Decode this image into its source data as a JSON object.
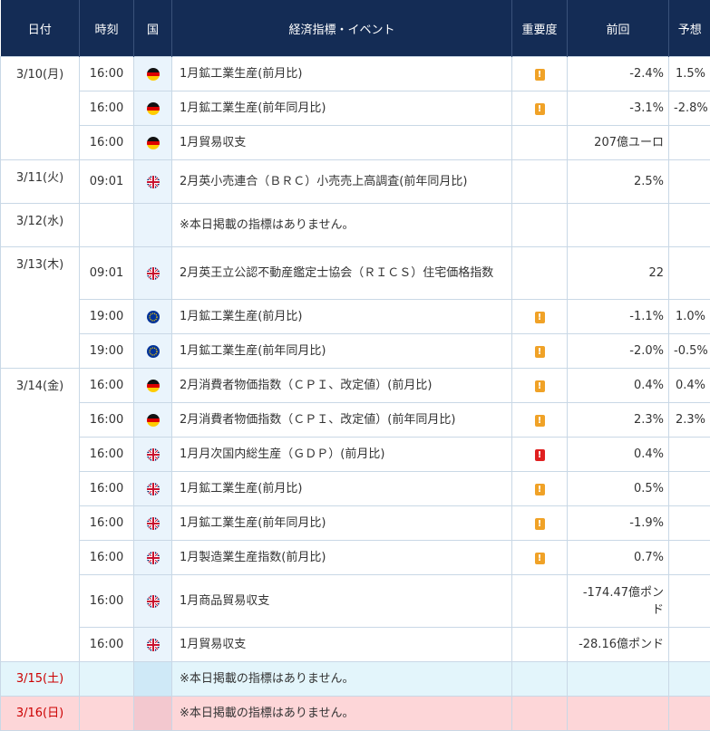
{
  "header": {
    "date": "日付",
    "time": "時刻",
    "country": "国",
    "event": "経済指標・イベント",
    "importance": "重要度",
    "previous": "前回",
    "forecast": "予想"
  },
  "rows": [
    {
      "date": "3/10(月)",
      "time": "16:00",
      "country_icon": "germany-flag-icon",
      "event": "1月鉱工業生産(前月比)",
      "importance": "medium",
      "previous": "-2.4%",
      "forecast": "1.5%"
    },
    {
      "date": "",
      "time": "16:00",
      "country_icon": "germany-flag-icon",
      "event": "1月鉱工業生産(前年同月比)",
      "importance": "medium",
      "previous": "-3.1%",
      "forecast": "-2.8%"
    },
    {
      "date": "",
      "time": "16:00",
      "country_icon": "germany-flag-icon",
      "event": "1月貿易収支",
      "importance": "",
      "previous": "207億ユーロ",
      "forecast": ""
    },
    {
      "date": "3/11(火)",
      "time": "09:01",
      "country_icon": "uk-flag-icon",
      "event": "2月英小売連合（ＢＲＣ）小売売上高調査(前年同月比)",
      "importance": "",
      "previous": "2.5%",
      "forecast": ""
    },
    {
      "date": "3/12(水)",
      "time": "",
      "country_icon": "",
      "event": "※本日掲載の指標はありません。",
      "importance": "",
      "previous": "",
      "forecast": ""
    },
    {
      "date": "3/13(木)",
      "time": "09:01",
      "country_icon": "uk-flag-icon",
      "event": "2月英王立公認不動産鑑定士協会（ＲＩＣＳ）住宅価格指数",
      "importance": "",
      "previous": "22",
      "forecast": ""
    },
    {
      "date": "",
      "time": "19:00",
      "country_icon": "eu-flag-icon",
      "event": "1月鉱工業生産(前月比)",
      "importance": "medium",
      "previous": "-1.1%",
      "forecast": "1.0%"
    },
    {
      "date": "",
      "time": "19:00",
      "country_icon": "eu-flag-icon",
      "event": "1月鉱工業生産(前年同月比)",
      "importance": "medium",
      "previous": "-2.0%",
      "forecast": "-0.5%"
    },
    {
      "date": "3/14(金)",
      "time": "16:00",
      "country_icon": "germany-flag-icon",
      "event": "2月消費者物価指数（ＣＰＩ、改定値）(前月比)",
      "importance": "medium",
      "previous": "0.4%",
      "forecast": "0.4%"
    },
    {
      "date": "",
      "time": "16:00",
      "country_icon": "germany-flag-icon",
      "event": "2月消費者物価指数（ＣＰＩ、改定値）(前年同月比)",
      "importance": "medium",
      "previous": "2.3%",
      "forecast": "2.3%"
    },
    {
      "date": "",
      "time": "16:00",
      "country_icon": "uk-flag-icon",
      "event": "1月月次国内総生産（ＧＤＰ）(前月比)",
      "importance": "high",
      "previous": "0.4%",
      "forecast": ""
    },
    {
      "date": "",
      "time": "16:00",
      "country_icon": "uk-flag-icon",
      "event": "1月鉱工業生産(前月比)",
      "importance": "medium",
      "previous": "0.5%",
      "forecast": ""
    },
    {
      "date": "",
      "time": "16:00",
      "country_icon": "uk-flag-icon",
      "event": "1月鉱工業生産(前年同月比)",
      "importance": "medium",
      "previous": "-1.9%",
      "forecast": ""
    },
    {
      "date": "",
      "time": "16:00",
      "country_icon": "uk-flag-icon",
      "event": "1月製造業生産指数(前月比)",
      "importance": "medium",
      "previous": "0.7%",
      "forecast": ""
    },
    {
      "date": "",
      "time": "16:00",
      "country_icon": "uk-flag-icon",
      "event": "1月商品貿易収支",
      "importance": "",
      "previous": "-174.47億ポンド",
      "forecast": ""
    },
    {
      "date": "",
      "time": "16:00",
      "country_icon": "uk-flag-icon",
      "event": "1月貿易収支",
      "importance": "",
      "previous": "-28.16億ポンド",
      "forecast": ""
    },
    {
      "date": "3/15(土)",
      "time": "",
      "country_icon": "",
      "event": "※本日掲載の指標はありません。",
      "importance": "",
      "previous": "",
      "forecast": ""
    },
    {
      "date": "3/16(日)",
      "time": "",
      "country_icon": "",
      "event": "※本日掲載の指標はありません。",
      "importance": "",
      "previous": "",
      "forecast": ""
    }
  ],
  "importance_marks": {
    "medium": "!",
    "high": "!"
  },
  "colors": {
    "header_bg": "#142c55",
    "medium": "#f0a227",
    "high": "#e02020",
    "saturday_bg": "#e3f5fb",
    "sunday_bg": "#fdd6d8",
    "weekend_date": "#cc0000"
  }
}
